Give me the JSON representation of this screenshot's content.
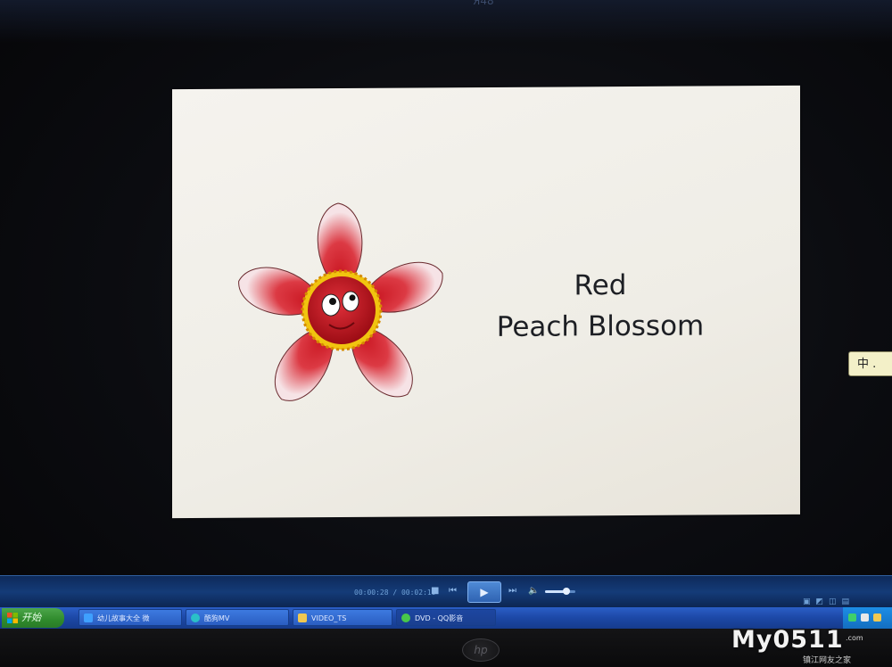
{
  "window": {
    "top_label": "Я48"
  },
  "video": {
    "title_line1": "Red",
    "title_line2": "Peach Blossom"
  },
  "ime": {
    "label": "中 ."
  },
  "player": {
    "time": "00:00:28 / 00:02:10",
    "stop_icon": "stop-icon",
    "prev_icon": "previous-icon",
    "play_icon": "play-icon",
    "next_icon": "next-icon",
    "volume_icon": "volume-icon",
    "volume_level": 0.7
  },
  "taskbar": {
    "start_label": "开始",
    "items": [
      {
        "label": "幼儿故事大全 微",
        "icon": "ie-icon"
      },
      {
        "label": "酷狗MV",
        "icon": "kugou-icon"
      },
      {
        "label": "VIDEO_TS",
        "icon": "folder-icon"
      },
      {
        "label": "DVD - QQ影音",
        "icon": "qqplayer-icon"
      }
    ]
  },
  "bezel": {
    "brand": "hp"
  },
  "watermark": {
    "text": "My0511",
    "domain": ".com",
    "subtitle": "镇江网友之家"
  },
  "colors": {
    "player_bar": "#143b78",
    "taskbar": "#2b5ec6",
    "start_button": "#3a9a37",
    "petal": "#d9323c",
    "flower_center": "#c8141f",
    "ime_bg": "#f3f0c8"
  }
}
